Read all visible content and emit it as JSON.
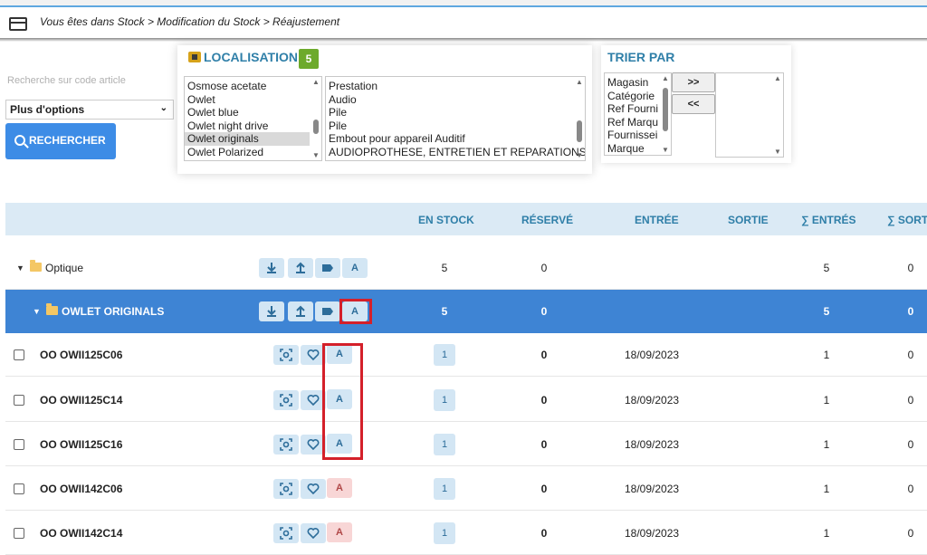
{
  "breadcrumb": "Vous êtes dans Stock > Modification du Stock > Réajustement",
  "search": {
    "placeholder": "Recherche sur code article",
    "options_label": "Plus d'options",
    "button_label": "RECHERCHER"
  },
  "localisation": {
    "title": "LOCALISATION",
    "badge": "5",
    "left_items": [
      "Osmose acetate",
      "Owlet",
      "Owlet blue",
      "Owlet night drive",
      "Owlet originals",
      "Owlet Polarized"
    ],
    "right_items": [
      "Prestation",
      "Audio",
      "Pile",
      "Pile",
      "Embout pour appareil Auditif",
      "AUDIOPROTHESE, ENTRETIEN ET REPARATIONS"
    ]
  },
  "trier": {
    "title": "TRIER PAR",
    "items": [
      "Magasin",
      "Catégorie",
      "Ref Fourni",
      "Ref Marqu",
      "Fournissei",
      "Marque"
    ],
    "add_label": ">>",
    "remove_label": "<<"
  },
  "table": {
    "headers": {
      "en_stock": "EN STOCK",
      "reserve": "RÉSERVÉ",
      "entree": "ENTRÉE",
      "sortie": "SORTIE",
      "sum_entres": "∑ ENTRÉS",
      "sum_sorties": "∑ SORTI"
    },
    "group": {
      "name": "Optique",
      "en_stock": "5",
      "reserve": "0",
      "sum_entres": "5",
      "sum_sorties": "0",
      "a_label": "A"
    },
    "subgroup": {
      "name": "OWLET ORIGINALS",
      "en_stock": "5",
      "reserve": "0",
      "sum_entres": "5",
      "sum_sorties": "0",
      "a_label": "A"
    },
    "rows": [
      {
        "code": "OO OWII125C06",
        "a_label": "A",
        "stock": "1",
        "reserve": "0",
        "entree": "18/09/2023",
        "sum_entres": "1",
        "sum_sorties": "0"
      },
      {
        "code": "OO OWII125C14",
        "a_label": "A",
        "stock": "1",
        "reserve": "0",
        "entree": "18/09/2023",
        "sum_entres": "1",
        "sum_sorties": "0"
      },
      {
        "code": "OO OWII125C16",
        "a_label": "A",
        "stock": "1",
        "reserve": "0",
        "entree": "18/09/2023",
        "sum_entres": "1",
        "sum_sorties": "0"
      },
      {
        "code": "OO OWII142C06",
        "a_label": "A",
        "stock": "1",
        "reserve": "0",
        "entree": "18/09/2023",
        "sum_entres": "1",
        "sum_sorties": "0"
      },
      {
        "code": "OO OWII142C14",
        "a_label": "A",
        "stock": "1",
        "reserve": "0",
        "entree": "18/09/2023",
        "sum_entres": "1",
        "sum_sorties": "0"
      }
    ]
  }
}
